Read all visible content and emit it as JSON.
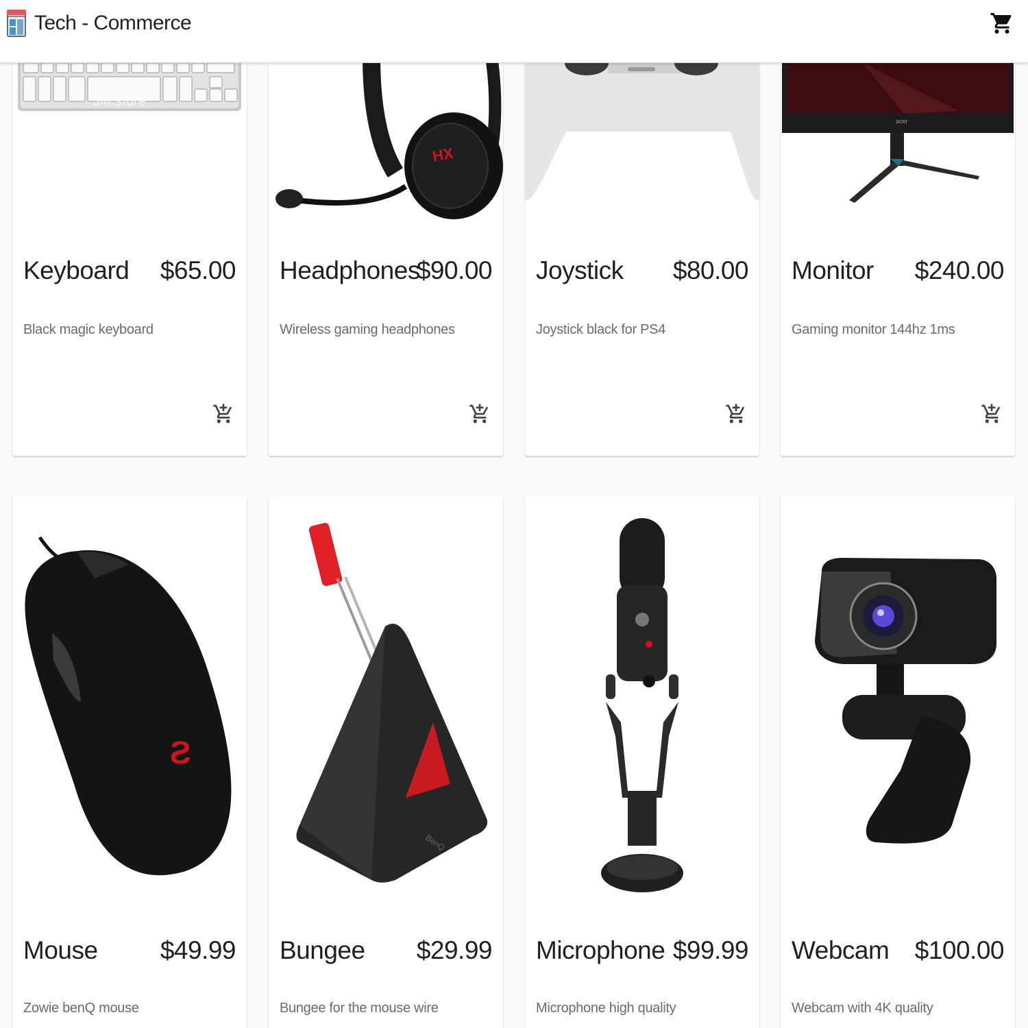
{
  "app": {
    "title": "Tech - Commerce",
    "logo_icon": "store-icon",
    "cart_icon": "shopping-cart-icon"
  },
  "products": [
    {
      "name": "Keyboard",
      "price": "$65.00",
      "description": "Black magic keyboard",
      "image_icon": "keyboard-image"
    },
    {
      "name": "Headphones",
      "price": "$90.00",
      "description": "Wireless gaming headphones",
      "image_icon": "headphones-image"
    },
    {
      "name": "Joystick",
      "price": "$80.00",
      "description": "Joystick black for PS4",
      "image_icon": "joystick-image"
    },
    {
      "name": "Monitor",
      "price": "$240.00",
      "description": "Gaming monitor 144hz 1ms",
      "image_icon": "monitor-image"
    },
    {
      "name": "Mouse",
      "price": "$49.99",
      "description": "Zowie benQ mouse",
      "image_icon": "mouse-image"
    },
    {
      "name": "Bungee",
      "price": "$29.99",
      "description": "Bungee for the mouse wire",
      "image_icon": "bungee-image"
    },
    {
      "name": "Microphone",
      "price": "$99.99",
      "description": "Microphone high quality",
      "image_icon": "microphone-image"
    },
    {
      "name": "Webcam",
      "price": "$100.00",
      "description": "Webcam with 4K quality",
      "image_icon": "webcam-image"
    }
  ],
  "add_to_cart_icon": "add-shopping-cart-icon",
  "colors": {
    "appbar": "#ffffff",
    "background": "#fafafa",
    "text": "#202020",
    "muted": "#6b6b6b",
    "accent_red": "#d0141c"
  }
}
